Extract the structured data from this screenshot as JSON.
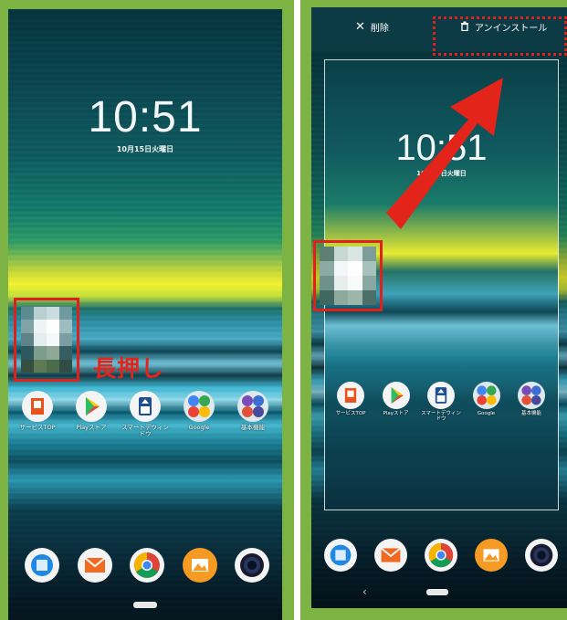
{
  "left": {
    "clock": {
      "time": "10:51",
      "date": "10月15日火曜日"
    },
    "annotation": "長押し",
    "apps": [
      {
        "label": "サービスTOP",
        "icon": "au-service-icon"
      },
      {
        "label": "Playストア",
        "icon": "play-store-icon"
      },
      {
        "label": "スマートデウィンドウ",
        "icon": "smart-window-icon"
      },
      {
        "label": "Google",
        "icon": "google-folder-icon"
      },
      {
        "label": "基本機能",
        "icon": "basic-functions-folder-icon"
      }
    ],
    "dock": [
      "phone-icon",
      "au-mail-icon",
      "chrome-icon",
      "gallery-icon",
      "camera-icon"
    ]
  },
  "right": {
    "topbar": {
      "delete_label": "削除",
      "uninstall_label": "アンインストール"
    },
    "clock": {
      "time": "10:51",
      "date": "10月15日火曜日"
    },
    "apps": [
      {
        "label": "サービスTOP",
        "icon": "au-service-icon"
      },
      {
        "label": "Playストア",
        "icon": "play-store-icon"
      },
      {
        "label": "スマートデウィンドウ",
        "icon": "smart-window-icon"
      },
      {
        "label": "Google",
        "icon": "google-folder-icon"
      },
      {
        "label": "基本機能",
        "icon": "basic-functions-folder-icon"
      }
    ],
    "dock": [
      "phone-icon",
      "au-mail-icon",
      "chrome-icon",
      "gallery-icon",
      "camera-icon"
    ],
    "back_glyph": "‹"
  },
  "colors": {
    "annotation_red": "#e0201a",
    "frame_green": "#7cb342"
  }
}
